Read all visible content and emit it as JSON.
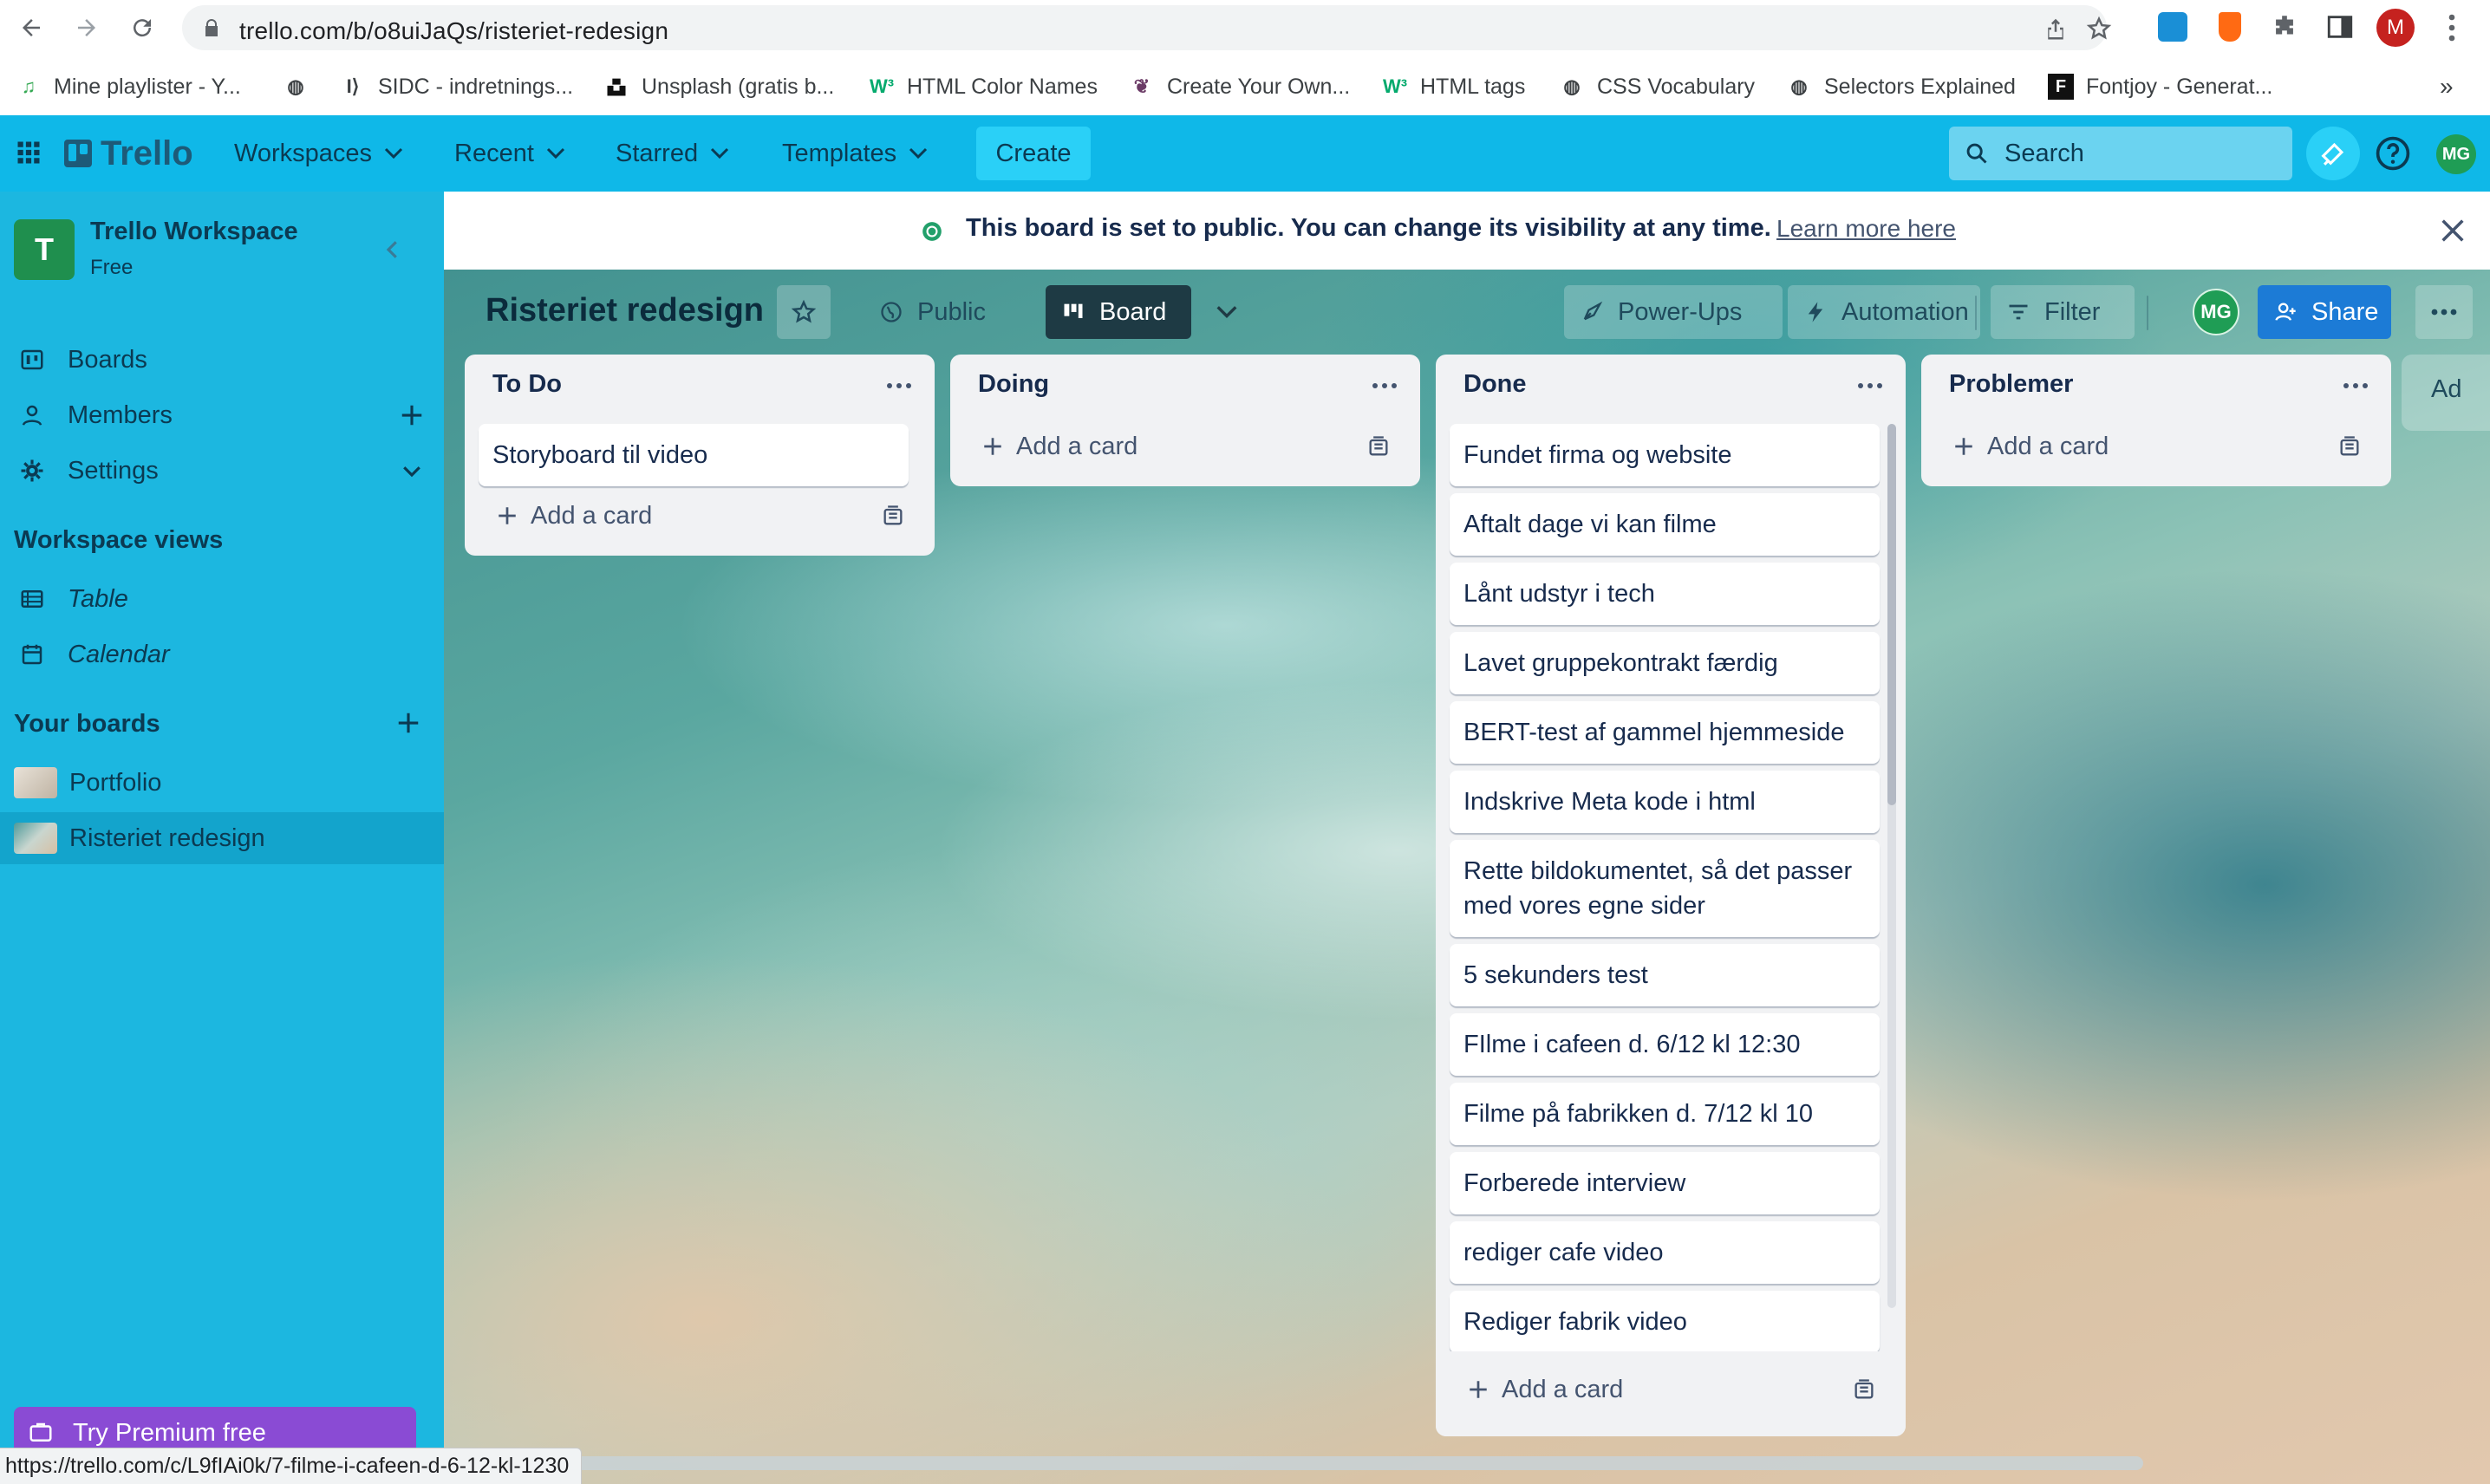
{
  "browser": {
    "url": "trello.com/b/o8uiJaQs/risteriet-redesign",
    "bookmarks": [
      {
        "label": "Mine playlister - Y...",
        "icon": "music-note-icon"
      },
      {
        "label": "",
        "icon": "globe-icon"
      },
      {
        "label": "SIDC - indretnings...",
        "icon": "sidc-icon"
      },
      {
        "label": "Unsplash (gratis b...",
        "icon": "unsplash-icon"
      },
      {
        "label": "HTML Color Names",
        "icon": "w3schools-icon"
      },
      {
        "label": "Create Your Own...",
        "icon": "brain-icon"
      },
      {
        "label": "HTML tags",
        "icon": "w3schools-icon"
      },
      {
        "label": "CSS Vocabulary",
        "icon": "globe-icon"
      },
      {
        "label": "Selectors Explained",
        "icon": "globe-icon"
      },
      {
        "label": "Fontjoy - Generat...",
        "icon": "fontjoy-icon"
      }
    ],
    "more_bookmarks": "»",
    "profile_initial": "M",
    "status_url": "https://trello.com/c/L9fIAi0k/7-filme-i-cafeen-d-6-12-kl-1230"
  },
  "header": {
    "logo": "Trello",
    "menus": [
      "Workspaces",
      "Recent",
      "Starred",
      "Templates"
    ],
    "create": "Create",
    "search_placeholder": "Search",
    "avatar": "MG"
  },
  "sidebar": {
    "workspace_initial": "T",
    "workspace_name": "Trello Workspace",
    "workspace_plan": "Free",
    "items": [
      "Boards",
      "Members",
      "Settings"
    ],
    "views_title": "Workspace views",
    "views": [
      "Table",
      "Calendar"
    ],
    "boards_title": "Your boards",
    "boards": [
      "Portfolio",
      "Risteriet redesign"
    ],
    "premium": "Try Premium free"
  },
  "banner": {
    "text": "This board is set to public. You can change its visibility at any time.",
    "link": "Learn more here"
  },
  "board": {
    "title": "Risteriet redesign",
    "visibility": "Public",
    "view": "Board",
    "power_ups": "Power-Ups",
    "automation": "Automation",
    "filter": "Filter",
    "member": "MG",
    "share": "Share",
    "add_list_peek": "Ad"
  },
  "lists": [
    {
      "title": "To Do",
      "cards": [
        "Storyboard til video"
      ],
      "add_card": "Add a card"
    },
    {
      "title": "Doing",
      "cards": [],
      "add_card": "Add a card"
    },
    {
      "title": "Done",
      "cards": [
        "Fundet firma og website",
        "Aftalt dage vi kan filme",
        "Lånt udstyr i tech",
        "Lavet gruppekontrakt færdig",
        "BERT-test af gammel hjemmeside",
        "Indskrive Meta kode i html",
        "Rette bildokumentet, så det passer med vores egne sider",
        "5 sekunders test",
        "FIlme i cafeen d. 6/12 kl 12:30",
        "Filme på fabrikken d. 7/12 kl 10",
        "Forberede interview",
        "rediger cafe video",
        "Rediger fabrik video"
      ],
      "add_card": "Add a card"
    },
    {
      "title": "Problemer",
      "cards": [],
      "add_card": "Add a card"
    }
  ],
  "colors": {
    "header_bg": "#0fb8e8",
    "sidebar_bg": "#1cb7e0",
    "list_bg": "#f1f2f4",
    "share_bg": "#1c7bd6",
    "premium_bg": "#8a4bd4"
  }
}
